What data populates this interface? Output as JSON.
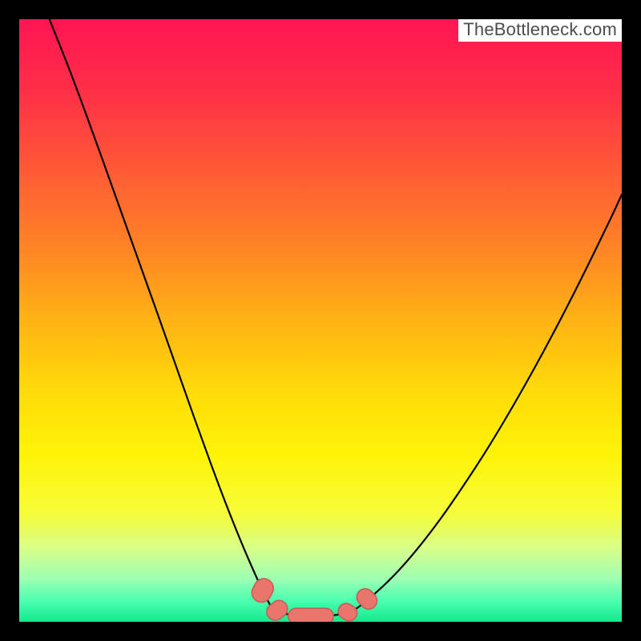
{
  "watermark": "TheBottleneck.com",
  "gradient": {
    "stops": [
      {
        "offset": 0.0,
        "color": "#ff1552"
      },
      {
        "offset": 0.12,
        "color": "#ff2f47"
      },
      {
        "offset": 0.25,
        "color": "#ff5a35"
      },
      {
        "offset": 0.38,
        "color": "#ff8425"
      },
      {
        "offset": 0.5,
        "color": "#ffb314"
      },
      {
        "offset": 0.62,
        "color": "#ffdc09"
      },
      {
        "offset": 0.72,
        "color": "#fff307"
      },
      {
        "offset": 0.82,
        "color": "#f6fd3a"
      },
      {
        "offset": 0.88,
        "color": "#d7ff8b"
      },
      {
        "offset": 0.93,
        "color": "#9cffb4"
      },
      {
        "offset": 0.965,
        "color": "#4affb0"
      },
      {
        "offset": 1.0,
        "color": "#15e98e"
      }
    ]
  },
  "curve_style": {
    "stroke": "#000000",
    "stroke_width": 2.2
  },
  "marker_style": {
    "fill": "#e8766d",
    "stroke": "#c65b53",
    "stroke_width": 1.5,
    "corner_radius": 7
  },
  "chart_data": {
    "type": "line",
    "title": "",
    "xlabel": "",
    "ylabel": "",
    "xlim": [
      0,
      100
    ],
    "ylim": [
      0,
      100
    ],
    "series": [
      {
        "name": "left-branch",
        "x": [
          5.0,
          8.0,
          11.0,
          14.0,
          17.0,
          20.0,
          23.0,
          26.0,
          29.0,
          32.0,
          35.0,
          38.0,
          41.0,
          42.5
        ],
        "y": [
          100.0,
          92.5,
          84.5,
          76.2,
          67.8,
          59.4,
          51.0,
          42.5,
          34.0,
          25.7,
          17.8,
          10.5,
          4.0,
          1.8
        ]
      },
      {
        "name": "valley-floor",
        "x": [
          42.5,
          45.0,
          48.0,
          51.0,
          53.0,
          55.0
        ],
        "y": [
          1.8,
          1.2,
          1.0,
          1.0,
          1.2,
          1.6
        ]
      },
      {
        "name": "right-branch",
        "x": [
          55.0,
          58.0,
          62.0,
          66.0,
          70.0,
          74.0,
          78.0,
          82.0,
          86.0,
          90.0,
          94.0,
          98.0,
          100.0
        ],
        "y": [
          1.6,
          3.8,
          7.5,
          12.0,
          17.2,
          23.0,
          29.2,
          35.9,
          43.0,
          50.5,
          58.4,
          66.6,
          70.9
        ]
      }
    ],
    "markers": [
      {
        "cx": 40.4,
        "cy": 5.2,
        "w": 4.0,
        "h": 3.2,
        "angle": -62
      },
      {
        "cx": 42.8,
        "cy": 1.9,
        "w": 3.6,
        "h": 2.8,
        "angle": -38
      },
      {
        "cx": 48.4,
        "cy": 0.95,
        "w": 7.5,
        "h": 2.6,
        "angle": 0
      },
      {
        "cx": 54.5,
        "cy": 1.6,
        "w": 3.2,
        "h": 2.6,
        "angle": 30
      },
      {
        "cx": 57.7,
        "cy": 3.8,
        "w": 3.6,
        "h": 2.8,
        "angle": 46
      }
    ]
  }
}
